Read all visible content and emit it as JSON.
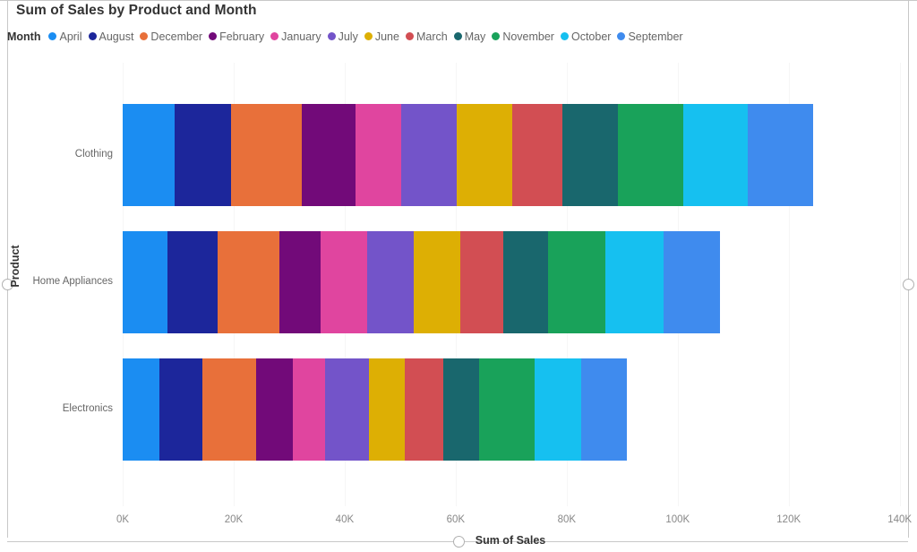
{
  "chart_data": {
    "type": "bar",
    "orientation": "horizontal",
    "stacked": true,
    "title": "Sum of Sales by Product and Month",
    "xlabel": "Sum of Sales",
    "ylabel": "Product",
    "legend_title": "Month",
    "legend_position": "top",
    "grid": true,
    "xlim": [
      0,
      140000
    ],
    "xticks": [
      0,
      20000,
      40000,
      60000,
      80000,
      100000,
      120000,
      140000
    ],
    "xtick_labels": [
      "0K",
      "20K",
      "40K",
      "60K",
      "80K",
      "100K",
      "120K",
      "140K"
    ],
    "categories": [
      "Clothing",
      "Home Appliances",
      "Electronics"
    ],
    "totals": [
      124400,
      107700,
      90800
    ],
    "series": [
      {
        "name": "April",
        "color": "#1b8df2",
        "values": [
          9400,
          8100,
          6600
        ]
      },
      {
        "name": "August",
        "color": "#1c269b",
        "values": [
          10200,
          9000,
          7700
        ]
      },
      {
        "name": "December",
        "color": "#e8703a",
        "values": [
          12700,
          11100,
          9800
        ]
      },
      {
        "name": "February",
        "color": "#720a79",
        "values": [
          9700,
          7400,
          6500
        ]
      },
      {
        "name": "January",
        "color": "#e0459f",
        "values": [
          8200,
          8400,
          5800
        ]
      },
      {
        "name": "July",
        "color": "#7354c9",
        "values": [
          10000,
          8500,
          7900
        ]
      },
      {
        "name": "June",
        "color": "#ddaf04",
        "values": [
          10000,
          8400,
          6600
        ]
      },
      {
        "name": "March",
        "color": "#d24e53",
        "values": [
          9000,
          7700,
          6800
        ]
      },
      {
        "name": "May",
        "color": "#19676d",
        "values": [
          10000,
          8100,
          6500
        ]
      },
      {
        "name": "November",
        "color": "#19a25a",
        "values": [
          11800,
          10300,
          10000
        ]
      },
      {
        "name": "October",
        "color": "#16c0f0",
        "values": [
          11600,
          10500,
          8500
        ]
      },
      {
        "name": "September",
        "color": "#3f8bee",
        "values": [
          11800,
          10200,
          8100
        ]
      }
    ]
  },
  "legend": {
    "title": "Month",
    "items": [
      {
        "label": "April",
        "color": "#1b8df2"
      },
      {
        "label": "August",
        "color": "#1c269b"
      },
      {
        "label": "December",
        "color": "#e8703a"
      },
      {
        "label": "February",
        "color": "#720a79"
      },
      {
        "label": "January",
        "color": "#e0459f"
      },
      {
        "label": "July",
        "color": "#7354c9"
      },
      {
        "label": "June",
        "color": "#ddaf04"
      },
      {
        "label": "March",
        "color": "#d24e53"
      },
      {
        "label": "May",
        "color": "#19676d"
      },
      {
        "label": "November",
        "color": "#19a25a"
      },
      {
        "label": "October",
        "color": "#16c0f0"
      },
      {
        "label": "September",
        "color": "#3f8bee"
      }
    ]
  },
  "header": {
    "title": "Sum of Sales by Product and Month"
  },
  "axes": {
    "x_title": "Sum of Sales",
    "y_title": "Product"
  },
  "colors": {
    "title_text": "#333333",
    "axis_text": "#666666",
    "tick_text": "#888888",
    "gridline": "#f6f6f6",
    "frame": "#c8c8c8",
    "background": "#ffffff"
  }
}
